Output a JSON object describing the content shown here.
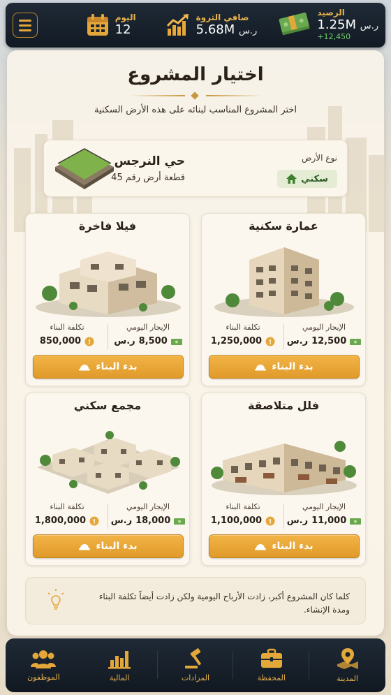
{
  "topbar": {
    "day": {
      "label": "اليوم",
      "value": "12",
      "icon": "calendar-icon"
    },
    "net_worth": {
      "label": "صافي الثروة",
      "value": "5.68M",
      "currency": "ر.س",
      "icon": "growth-chart-icon"
    },
    "balance": {
      "label": "الرصيد",
      "value": "1.25M",
      "currency": "ر.س",
      "delta": "+12,450",
      "icon": "money-stack-icon"
    },
    "menu_icon": "hamburger-menu-icon"
  },
  "screen": {
    "title": "اختيار المشروع",
    "subtitle": "اختر المشروع المناسب لبنائه على هذه الأرض السكنية"
  },
  "land": {
    "type_label": "نوع الأرض",
    "type_value": "سكني",
    "name": "حي النرجس",
    "plot": "قطعة أرض رقم 45"
  },
  "projects": [
    {
      "name": "عمارة سكنية",
      "rent_label": "الإيجار اليومي",
      "rent": "12,500",
      "rent_currency": "ر.س",
      "cost_label": "تكلفة البناء",
      "cost": "1,250,000",
      "button": "بدء البناء"
    },
    {
      "name": "فيلا فاخرة",
      "rent_label": "الإيجار اليومي",
      "rent": "8,500",
      "rent_currency": "ر.س",
      "cost_label": "تكلفة البناء",
      "cost": "850,000",
      "button": "بدء البناء"
    },
    {
      "name": "فلل متلاصقة",
      "rent_label": "الإيجار اليومي",
      "rent": "11,000",
      "rent_currency": "ر.س",
      "cost_label": "تكلفة البناء",
      "cost": "1,100,000",
      "button": "بدء البناء"
    },
    {
      "name": "مجمع سكني",
      "rent_label": "الإيجار اليومي",
      "rent": "18,000",
      "rent_currency": "ر.س",
      "cost_label": "تكلفة البناء",
      "cost": "1,800,000",
      "button": "بدء البناء"
    }
  ],
  "tip": {
    "text": "كلما كان المشروع أكبر، زادت الأرباح اليومية ولكن زادت أيضاً تكلفة البناء ومدة الإنشاء.",
    "icon": "lightbulb-icon"
  },
  "nav": [
    {
      "label": "الموظفون",
      "icon": "employees-icon"
    },
    {
      "label": "المالية",
      "icon": "bar-chart-icon"
    },
    {
      "label": "المزادات",
      "icon": "gavel-icon"
    },
    {
      "label": "المحفظة",
      "icon": "briefcase-icon"
    },
    {
      "label": "المدينة",
      "icon": "map-pin-icon"
    }
  ],
  "colors": {
    "accent": "#e4a73a",
    "dark": "#18212c",
    "positive": "#6fd16a",
    "land_tag_bg": "#e4ecd3"
  }
}
